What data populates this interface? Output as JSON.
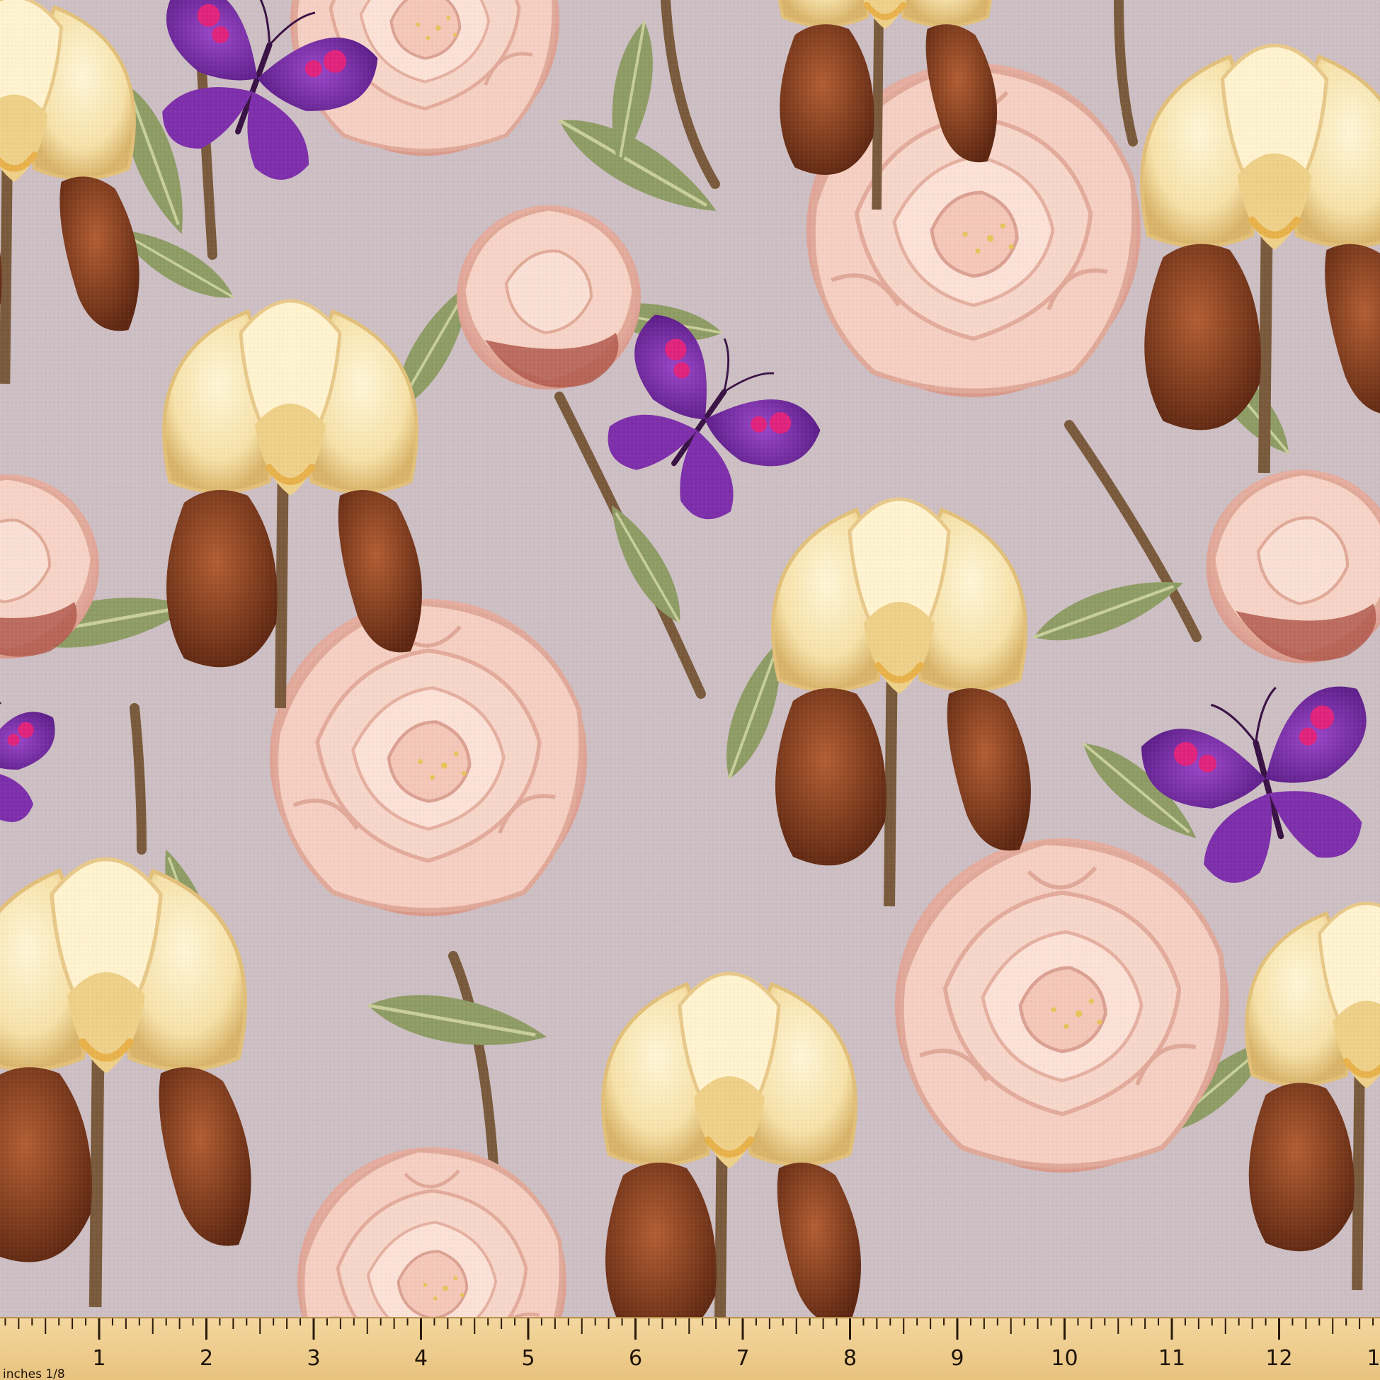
{
  "image": {
    "subject": "watercolor floral fabric swatch",
    "background_color": "#cdbfc3",
    "colors": {
      "peony": "#f2c9bb",
      "peony_shade": "#d99c8d",
      "iris_cream": "#f7e6b4",
      "iris_brown": "#7a3a1f",
      "leaf": "#8d9a63",
      "stem": "#7a5a3c",
      "butterfly": "#7b2fa6",
      "butterfly_spot": "#e0247d",
      "ruler": "#f0cf8f"
    },
    "icons": [
      "peony",
      "iris",
      "butterfly",
      "leaf",
      "ruler"
    ]
  },
  "ruler": {
    "unit_label": "inches 1/8",
    "numbers": [
      "1",
      "2",
      "3",
      "4",
      "5",
      "6",
      "7",
      "8",
      "9",
      "10",
      "11",
      "12",
      "1"
    ]
  }
}
